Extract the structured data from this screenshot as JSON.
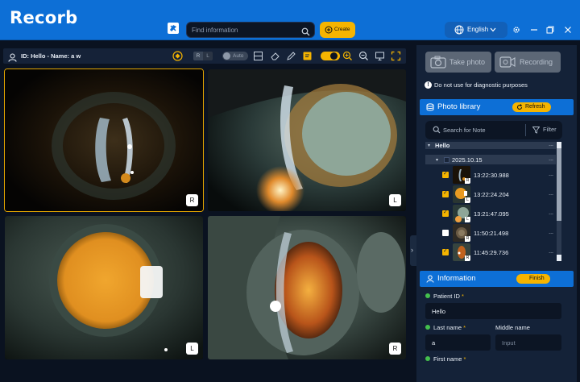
{
  "app": {
    "logo_text": "Recorb"
  },
  "header": {
    "search_placeholder": "Find information",
    "create_label": "Create",
    "language": "English"
  },
  "toolbar": {
    "patient_label": "ID: Hello - Name: a w",
    "eye_right": "R",
    "eye_left": "L",
    "auto_label": "Auto"
  },
  "images": [
    {
      "eye": "R",
      "selected": true
    },
    {
      "eye": "L",
      "selected": false
    },
    {
      "eye": "L",
      "selected": false
    },
    {
      "eye": "R",
      "selected": false
    }
  ],
  "capture": {
    "take_photo_label": "Take photo",
    "recording_label": "Recording",
    "warning": "Do not use for diagnostic purposes"
  },
  "library": {
    "title": "Photo library",
    "refresh_label": "Refresh",
    "search_placeholder": "Search for Note",
    "filter_label": "Filter",
    "patient_node": "Hello",
    "date_node": "2025.10.15",
    "photos": [
      {
        "time": "13:22:30.988",
        "checked": true,
        "eye": "R"
      },
      {
        "time": "13:22:24.204",
        "checked": true,
        "eye": "L"
      },
      {
        "time": "13:21:47.095",
        "checked": true,
        "eye": "L"
      },
      {
        "time": "11:50:21.498",
        "checked": false,
        "eye": "R"
      },
      {
        "time": "11:45:29.736",
        "checked": true,
        "eye": "R"
      }
    ],
    "more": "..."
  },
  "information": {
    "title": "Information",
    "finish_label": "Finish",
    "patient_id_label": "Patient ID",
    "patient_id_value": "Hello",
    "last_name_label": "Last name",
    "last_name_value": "a",
    "middle_name_label": "Middle name",
    "middle_name_placeholder": "Input",
    "first_name_label": "First name",
    "required_mark": "*"
  },
  "colors": {
    "accent": "#0d6fd6",
    "highlight": "#f5b400",
    "panel": "#142238",
    "background": "#0a1220"
  }
}
